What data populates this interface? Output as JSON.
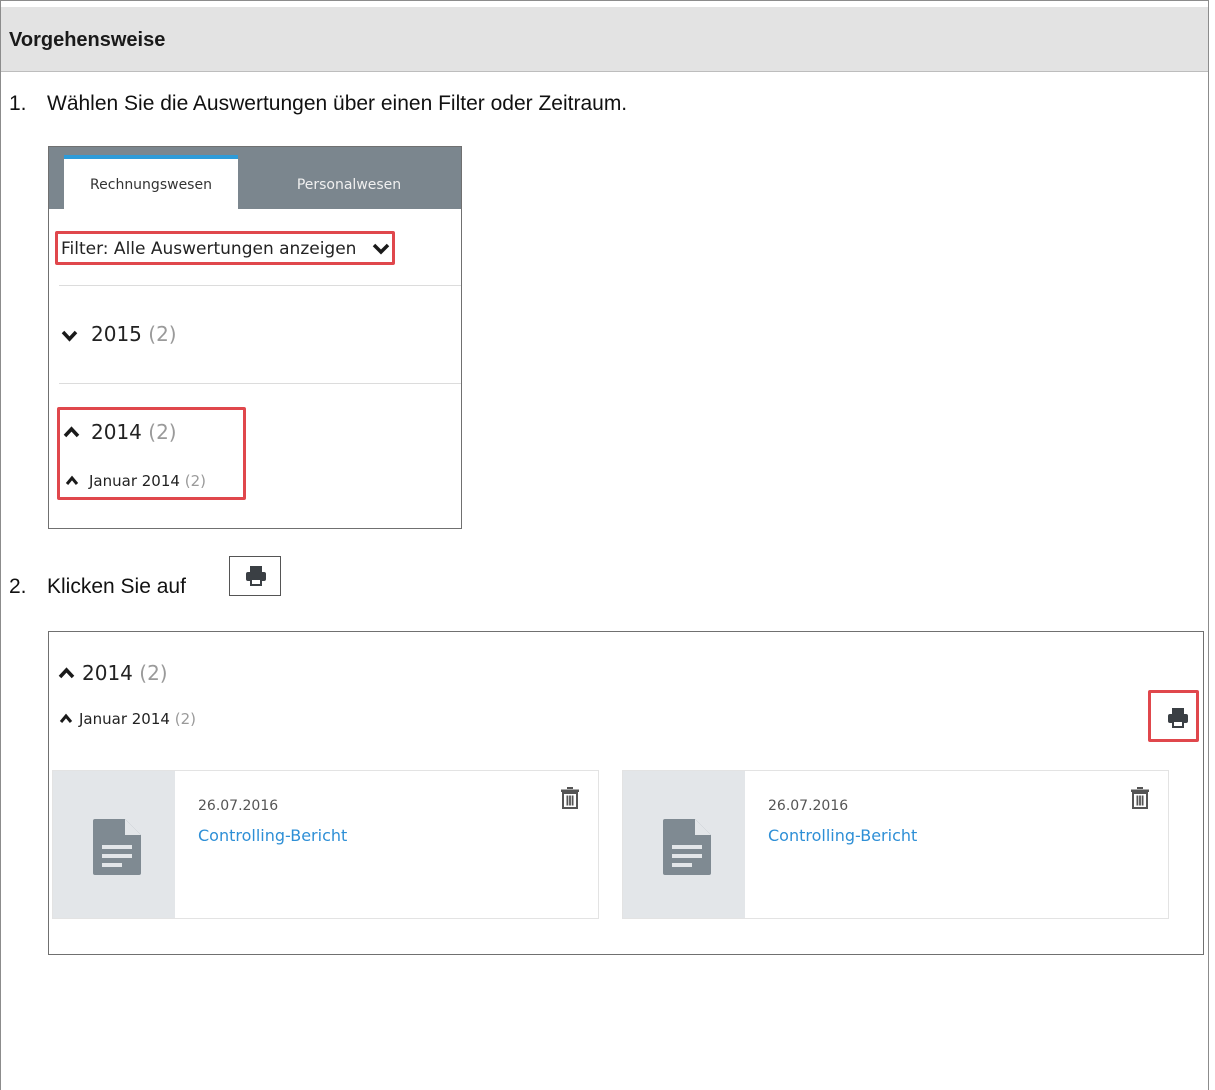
{
  "header": {
    "title": "Vorgehensweise"
  },
  "steps": [
    {
      "number": "1.",
      "text": "Wählen Sie die Auswertungen über einen Filter oder Zeitraum."
    },
    {
      "number": "2.",
      "text": "Klicken Sie auf"
    }
  ],
  "screenshot1": {
    "tabs": [
      {
        "label": "Rechnungswesen",
        "active": true
      },
      {
        "label": "Personalwesen",
        "active": false
      }
    ],
    "filter_label": "Filter: Alle Auswertungen anzeigen",
    "years": [
      {
        "year": "2015",
        "count": "(2)",
        "expanded": false
      },
      {
        "year": "2014",
        "count": "(2)",
        "expanded": true
      }
    ],
    "month": {
      "label": "Januar 2014",
      "count": "(2)"
    }
  },
  "screenshot2": {
    "year": {
      "label": "2014",
      "count": "(2)"
    },
    "month": {
      "label": "Januar 2014",
      "count": "(2)"
    },
    "cards": [
      {
        "date": "26.07.2016",
        "title": "Controlling-Bericht"
      },
      {
        "date": "26.07.2016",
        "title": "Controlling-Bericht"
      }
    ]
  },
  "colors": {
    "highlight": "#e0474c",
    "tab_accent": "#2e9bd8",
    "link": "#2e8fd6",
    "tabbar": "#7b868e"
  }
}
